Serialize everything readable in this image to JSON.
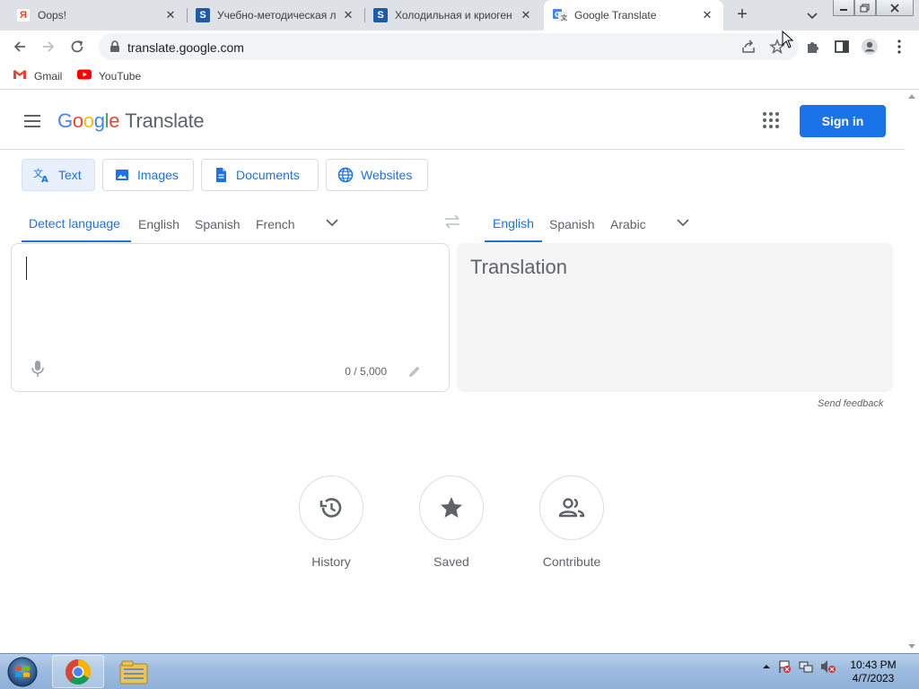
{
  "browser": {
    "tabs": [
      {
        "title": "Oops!",
        "favicon": "yandex-icon",
        "active": false
      },
      {
        "title": "Учебно-методическая л",
        "favicon": "s-icon",
        "active": false
      },
      {
        "title": "Холодильная и криоген",
        "favicon": "s-icon",
        "active": false
      },
      {
        "title": "Google Translate",
        "favicon": "google-translate-icon",
        "active": true
      }
    ],
    "new_tab": "+",
    "address": "translate.google.com",
    "bookmarks": [
      {
        "label": "Gmail",
        "icon": "gmail-icon"
      },
      {
        "label": "YouTube",
        "icon": "youtube-icon"
      }
    ]
  },
  "app": {
    "logo_google": [
      "G",
      "o",
      "o",
      "g",
      "l",
      "e"
    ],
    "logo_product": "Translate",
    "sign_in": "Sign in",
    "modes": [
      {
        "label": "Text",
        "icon": "translate-icon",
        "selected": true
      },
      {
        "label": "Images",
        "icon": "image-icon",
        "selected": false
      },
      {
        "label": "Documents",
        "icon": "document-icon",
        "selected": false
      },
      {
        "label": "Websites",
        "icon": "globe-icon",
        "selected": false
      }
    ],
    "source_languages": [
      "Detect language",
      "English",
      "Spanish",
      "French"
    ],
    "target_languages": [
      "English",
      "Spanish",
      "Arabic"
    ],
    "source": {
      "value": "",
      "char_count": "0 / 5,000"
    },
    "target": {
      "placeholder": "Translation"
    },
    "send_feedback": "Send feedback",
    "features": [
      {
        "label": "History",
        "icon": "history-icon"
      },
      {
        "label": "Saved",
        "icon": "star-icon"
      },
      {
        "label": "Contribute",
        "icon": "people-icon"
      }
    ]
  },
  "taskbar": {
    "time": "10:43 PM",
    "date": "4/7/2023"
  },
  "colors": {
    "accent": "#1a73e8",
    "google_blue": "#4285f4",
    "google_red": "#ea4335",
    "google_yellow": "#fbbc05",
    "google_green": "#34a853"
  }
}
